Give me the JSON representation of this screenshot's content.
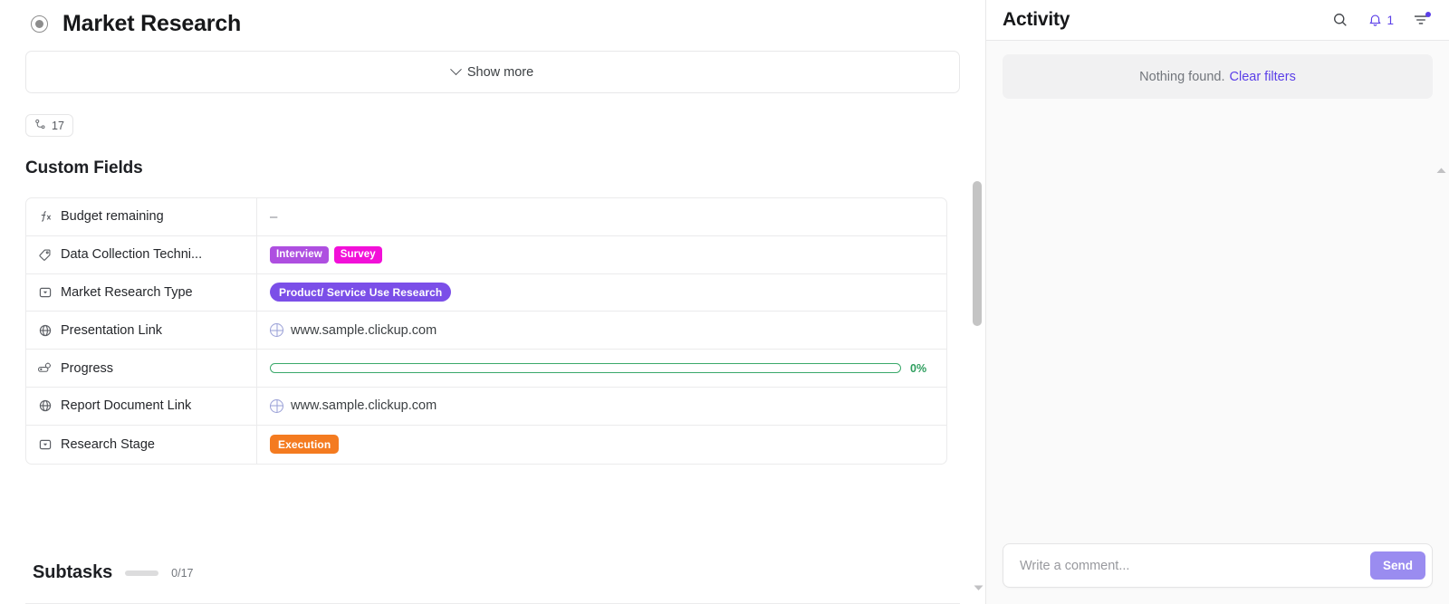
{
  "task": {
    "status_icon": "status-circle-icon",
    "title": "Market Research",
    "show_more_label": "Show more",
    "subtask_badge_count": "17",
    "subtask_badge_icon": "subtask-branch-icon"
  },
  "custom_fields": {
    "heading": "Custom Fields",
    "rows": [
      {
        "icon": "formula-icon",
        "label": "Budget remaining",
        "type": "empty",
        "value": "–"
      },
      {
        "icon": "tag-icon",
        "label": "Data Collection Techni...",
        "type": "tags",
        "tags": [
          {
            "label": "Interview",
            "color": "#ae4fe0"
          },
          {
            "label": "Survey",
            "color": "#f210d8"
          }
        ]
      },
      {
        "icon": "dropdown-icon",
        "label": "Market Research Type",
        "type": "pill",
        "pill": {
          "label": "Product/ Service Use Research",
          "color": "#7b4fe8"
        }
      },
      {
        "icon": "globe-icon",
        "label": "Presentation Link",
        "type": "link",
        "value": "www.sample.clickup.com"
      },
      {
        "icon": "progress-icon",
        "label": "Progress",
        "type": "progress",
        "progress": {
          "percent": 0,
          "percent_label": "0%",
          "color": "#3aa96a"
        }
      },
      {
        "icon": "globe-icon",
        "label": "Report Document Link",
        "type": "link",
        "value": "www.sample.clickup.com"
      },
      {
        "icon": "dropdown-icon",
        "label": "Research Stage",
        "type": "pill",
        "pill": {
          "label": "Execution",
          "color": "#f47b20"
        }
      }
    ]
  },
  "subtasks": {
    "title": "Subtasks",
    "count": "0/17"
  },
  "activity": {
    "title": "Activity",
    "search_icon": "search-icon",
    "bell_icon": "bell-icon",
    "bell_count": "1",
    "filter_icon": "filter-icon",
    "empty_message": "Nothing found.",
    "clear_filters_label": "Clear filters",
    "comment_placeholder": "Write a comment...",
    "send_label": "Send"
  },
  "colors": {
    "accent": "#5b3fe8",
    "send_button": "#9a8cf0",
    "progress_green": "#3aa96a"
  }
}
